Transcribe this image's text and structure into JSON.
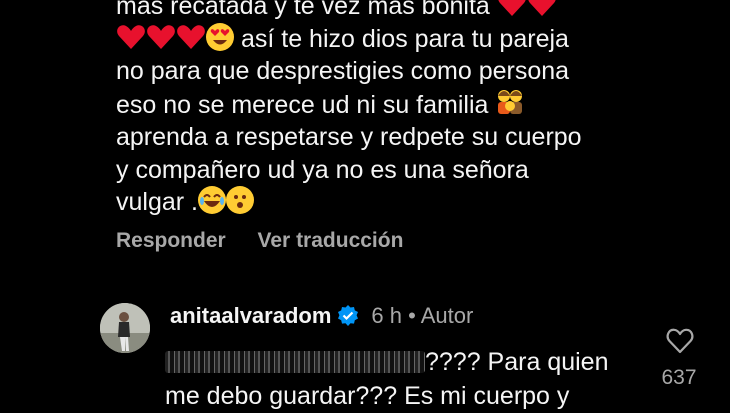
{
  "comment": {
    "lines": [
      "más  recatada  y te vez más bonita",
      "así te hizo dios para tu pareja",
      "no para que  desprestigies como persona",
      "eso no se merece  ud ni su familia",
      "aprenda a respetarse  y redpete su cuerpo",
      "y compañero ud ya no es una señora",
      "vulgar ."
    ]
  },
  "actions": {
    "reply": "Responder",
    "translate": "Ver traducción"
  },
  "reply": {
    "username": "anitaalvaradom",
    "time": "6 h",
    "separator": "•",
    "role": "Autor",
    "text_line1": "???? Para quien",
    "text_line2": "me debo guardar??? Es mi cuerpo y"
  },
  "likes": {
    "count": "637"
  },
  "icons": {
    "heart": "heart-emoji-icon",
    "face": "heart-eyes-emoji-icon",
    "like": "like-heart-icon",
    "verified": "verified-badge-icon"
  },
  "colors": {
    "heart_emoji": "#e8112d",
    "verified": "#0095f6",
    "muted": "#a8a8a8"
  }
}
